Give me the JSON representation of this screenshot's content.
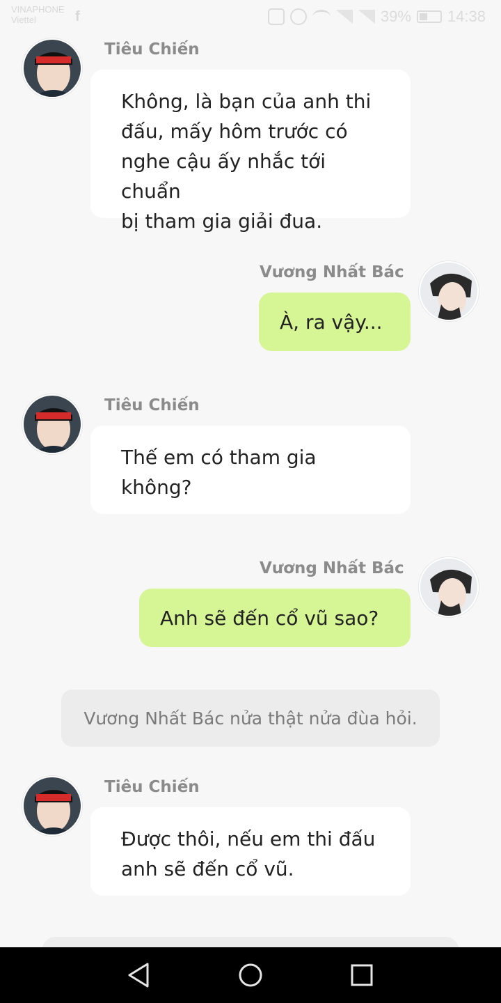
{
  "status_bar": {
    "carrier_line1": "VINAPHONE",
    "carrier_line2": "Viettel",
    "app_icon": "facebook-icon",
    "battery": "39%",
    "time": "14:38",
    "icons": [
      "vibrate-icon",
      "alarm-icon",
      "wifi-icon",
      "signal-icon",
      "signal-icon",
      "battery-icon"
    ]
  },
  "chat": {
    "messages": [
      {
        "sender": "Tiêu Chiến",
        "side": "left",
        "text": "Không, là bạn của anh thi\nđấu, mấy hôm trước có\nnghe cậu ấy nhắc tới chuẩn\nbị tham gia giải đua."
      },
      {
        "sender": "Vương Nhất Bác",
        "side": "right",
        "text": "À, ra vậy..."
      },
      {
        "sender": "Tiêu Chiến",
        "side": "left",
        "text": "Thế em có tham gia\nkhông?"
      },
      {
        "sender": "Vương Nhất Bác",
        "side": "right",
        "text": "Anh sẽ đến cổ vũ sao?"
      },
      {
        "sender": "Tiêu Chiến",
        "side": "left",
        "text": "Được thôi, nếu em thi đấu\nanh sẽ đến cổ vũ."
      }
    ],
    "narration": "Vương Nhất Bác nửa thật nửa đùa hỏi."
  },
  "nav_bar": {
    "icons": [
      "back-icon",
      "home-icon",
      "recents-icon"
    ]
  },
  "colors": {
    "background": "#f7f7f7",
    "left_bubble": "#ffffff",
    "right_bubble": "#d6f595",
    "narration_bg": "#ececec",
    "name_text": "#8b8b8b"
  }
}
